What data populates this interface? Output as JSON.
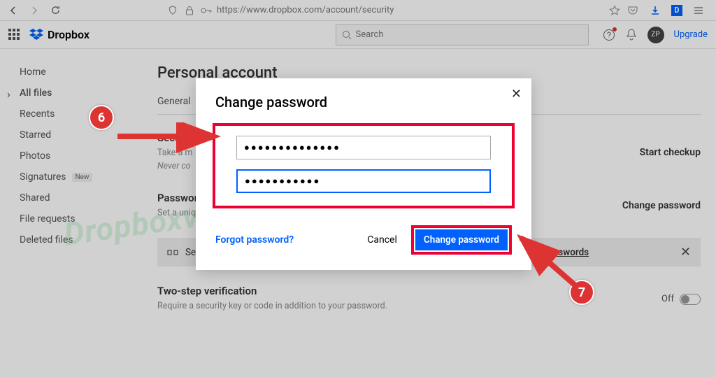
{
  "browser": {
    "url": "https://www.dropbox.com/account/security"
  },
  "brand": {
    "name": "Dropbox"
  },
  "search": {
    "placeholder": "Search"
  },
  "header": {
    "avatar_initials": "ZP",
    "upgrade": "Upgrade"
  },
  "sidebar": {
    "items": [
      {
        "label": "Home"
      },
      {
        "label": "All files",
        "active": true,
        "chevron": true
      },
      {
        "label": "Recents"
      },
      {
        "label": "Starred"
      },
      {
        "label": "Photos"
      },
      {
        "label": "Signatures",
        "badge": "New"
      },
      {
        "label": "Shared"
      },
      {
        "label": "File requests"
      },
      {
        "label": "Deleted files"
      }
    ]
  },
  "page": {
    "title": "Personal account",
    "tab_general": "General"
  },
  "security_checkup": {
    "title": "Security checkup",
    "line1_prefix": "Take a m",
    "line2_prefix": "Never co",
    "action": "Start checkup"
  },
  "password_section": {
    "title": "Password",
    "sub": "Set a unique password to protect your personal Dropbox account.",
    "action": "Change password"
  },
  "banner": {
    "text": "Secure all your passwords with the Dropbox password manager.",
    "link": "Download Dropbox Passwords"
  },
  "twostep": {
    "title": "Two-step verification",
    "sub": "Require a security key or code in addition to your password.",
    "state": "Off"
  },
  "modal": {
    "title": "Change password",
    "pwd1": "●●●●●●●●●●●●●●",
    "pwd2": "●●●●●●●●●●●",
    "forgot": "Forgot password?",
    "cancel": "Cancel",
    "submit": "Change password"
  },
  "annotations": {
    "n6": "6",
    "n7": "7"
  },
  "watermark": "Dropboxvietnam.net"
}
